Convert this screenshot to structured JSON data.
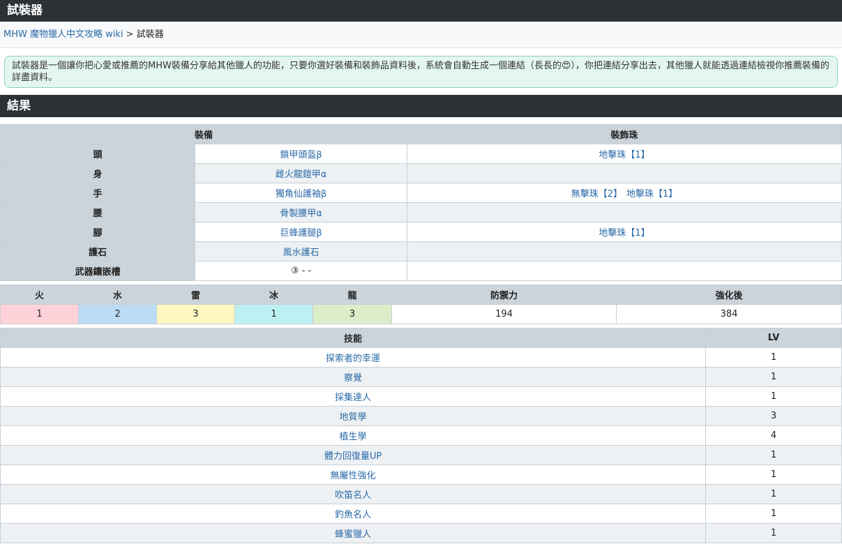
{
  "page": {
    "title": "試裝器",
    "breadcrumb": {
      "home": "MHW 魔物獵人中文攻略 wiki",
      "separator": ">",
      "current": "試裝器"
    },
    "intro": "試裝器是一個讓你把心愛或推薦的MHW裝備分享給其他獵人的功能，只要你選好裝備和裝飾品資料後，系統會自動生成一個連結（長長的😍），你把連結分享出去，其他獵人就能透過連結檢視你推薦裝備的詳盡資料。",
    "section_title": "結果"
  },
  "equipment": {
    "header_equip": "裝備",
    "header_deco": "裝飾珠",
    "rows": [
      {
        "slot": "頭",
        "item": "鎖甲頭盔β",
        "decos": [
          "地擊珠【1】"
        ]
      },
      {
        "slot": "身",
        "item": "雌火龍鎧甲α",
        "decos": []
      },
      {
        "slot": "手",
        "item": "獨角仙護袖β",
        "decos": [
          "無擊珠【2】",
          "地擊珠【1】"
        ]
      },
      {
        "slot": "腰",
        "item": "骨製腰甲α",
        "decos": []
      },
      {
        "slot": "腳",
        "item": "巨蜂護腿β",
        "decos": [
          "地擊珠【1】"
        ]
      },
      {
        "slot": "護石",
        "item": "風水護石",
        "decos": []
      },
      {
        "slot": "武器鑲嵌槽",
        "item": "③ - -",
        "decos": []
      }
    ]
  },
  "resistances": {
    "headers": [
      "火",
      "水",
      "雷",
      "冰",
      "龍",
      "防禦力",
      "強化後"
    ],
    "values": [
      "1",
      "2",
      "3",
      "1",
      "3",
      "194",
      "384"
    ],
    "colors": [
      "#ffd1d8",
      "#bcdcf6",
      "#fff7c2",
      "#bdf0f3",
      "#dcedc9",
      "#ffffff",
      "#ffffff"
    ]
  },
  "skills": {
    "header_name": "技能",
    "header_lv": "LV",
    "rows": [
      {
        "name": "探索者的幸運",
        "lv": "1"
      },
      {
        "name": "察覺",
        "lv": "1"
      },
      {
        "name": "採集達人",
        "lv": "1"
      },
      {
        "name": "地質學",
        "lv": "3"
      },
      {
        "name": "植生學",
        "lv": "4"
      },
      {
        "name": "體力回復量UP",
        "lv": "1"
      },
      {
        "name": "無屬性強化",
        "lv": "1"
      },
      {
        "name": "吹笛名人",
        "lv": "1"
      },
      {
        "name": "釣魚名人",
        "lv": "1"
      },
      {
        "name": "蜂蜜獵人",
        "lv": "1"
      }
    ]
  }
}
